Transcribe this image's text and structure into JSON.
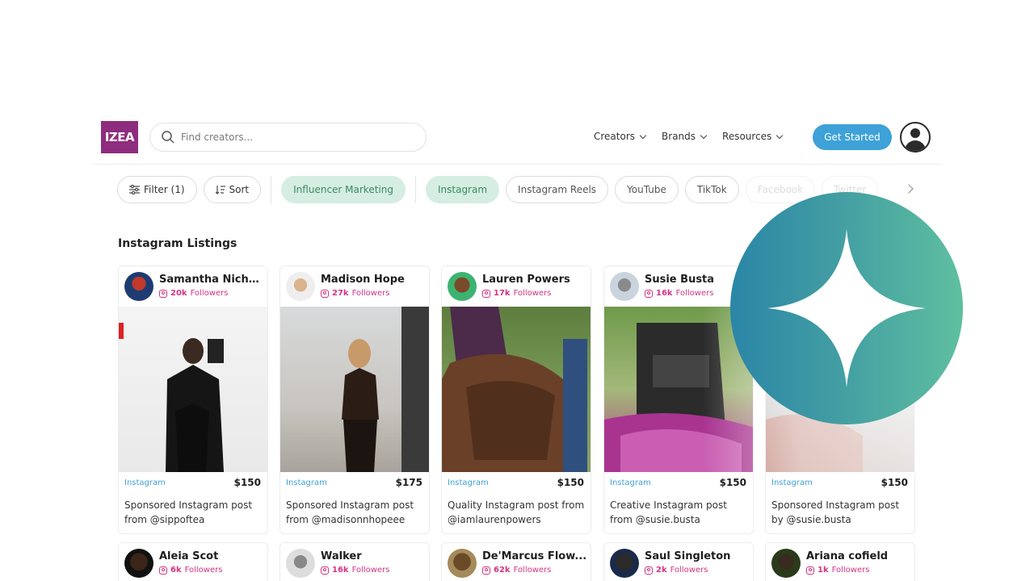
{
  "header": {
    "logo_text": "IZEA",
    "search_placeholder": "Find creators...",
    "nav": [
      {
        "label": "Creators"
      },
      {
        "label": "Brands"
      },
      {
        "label": "Resources"
      }
    ],
    "cta_label": "Get Started"
  },
  "filters": {
    "filter_label": "Filter (1)",
    "sort_label": "Sort",
    "category": "Influencer Marketing",
    "platforms": [
      "Instagram",
      "Instagram Reels",
      "YouTube",
      "TikTok",
      "Facebook",
      "Twitter"
    ]
  },
  "section_title": "Instagram Listings",
  "listings": [
    {
      "name": "Samantha Nichol...",
      "followers": "20k",
      "followers_suffix": "Followers",
      "platform": "Instagram",
      "price": "$150",
      "desc_1": "Sponsored Instagram post",
      "desc_2": "from @sippoftea"
    },
    {
      "name": "Madison Hope",
      "followers": "27k",
      "followers_suffix": "Followers",
      "platform": "Instagram",
      "price": "$175",
      "desc_1": "Sponsored Instagram post",
      "desc_2": "from @madisonnhopeee"
    },
    {
      "name": "Lauren Powers",
      "followers": "17k",
      "followers_suffix": "Followers",
      "platform": "Instagram",
      "price": "$150",
      "desc_1": "Quality Instagram post from",
      "desc_2": "@iamlaurenpowers"
    },
    {
      "name": "Susie Busta",
      "followers": "16k",
      "followers_suffix": "Followers",
      "platform": "Instagram",
      "price": "$150",
      "desc_1": "Creative Instagram post",
      "desc_2": "from @susie.busta"
    },
    {
      "name": "",
      "followers": "",
      "followers_suffix": "",
      "platform": "Instagram",
      "price": "$150",
      "desc_1": "Sponsored Instagram post",
      "desc_2": "by @susie.busta"
    }
  ],
  "listings_row2": [
    {
      "name": "Aleia Scot",
      "followers": "6k",
      "followers_suffix": "Followers"
    },
    {
      "name": "Walker",
      "followers": "16k",
      "followers_suffix": "Followers"
    },
    {
      "name": "De'Marcus Flow...",
      "followers": "62k",
      "followers_suffix": "Followers"
    },
    {
      "name": "Saul Singleton",
      "followers": "2k",
      "followers_suffix": "Followers"
    },
    {
      "name": "Ariana cofield",
      "followers": "1k",
      "followers_suffix": "Followers"
    }
  ],
  "colors": {
    "brand": "#8e2c7e",
    "cta": "#3ea2d8",
    "chip_active_bg": "#d5eee1",
    "chip_active_text": "#3c8a64",
    "followers": "#d63384",
    "sparkle_gradient_start": "#2a86a6",
    "sparkle_gradient_end": "#5fbfa0"
  },
  "icons": [
    "search-icon",
    "chevron-down-icon",
    "user-avatar-icon",
    "filter-icon",
    "sort-icon",
    "chevron-right-icon",
    "instagram-icon",
    "sparkle-icon"
  ]
}
